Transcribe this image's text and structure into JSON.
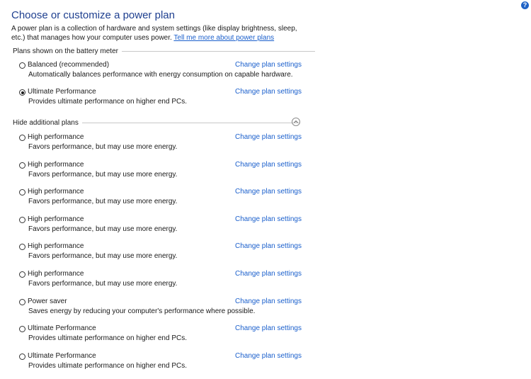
{
  "help_glyph": "?",
  "title": "Choose or customize a power plan",
  "intro": {
    "text": "A power plan is a collection of hardware and system settings (like display brightness, sleep, etc.) that manages how your computer uses power. ",
    "link": "Tell me more about power plans"
  },
  "sections": {
    "battery_meter": "Plans shown on the battery meter",
    "additional": "Hide additional plans"
  },
  "change_label": "Change plan settings",
  "plans_primary": [
    {
      "name": "Balanced (recommended)",
      "desc": "Automatically balances performance with energy consumption on capable hardware.",
      "checked": false
    },
    {
      "name": "Ultimate Performance",
      "desc": "Provides ultimate performance on higher end PCs.",
      "checked": true
    }
  ],
  "plans_additional": [
    {
      "name": "High performance",
      "desc": "Favors performance, but may use more energy.",
      "checked": false
    },
    {
      "name": "High performance",
      "desc": "Favors performance, but may use more energy.",
      "checked": false
    },
    {
      "name": "High performance",
      "desc": "Favors performance, but may use more energy.",
      "checked": false
    },
    {
      "name": "High performance",
      "desc": "Favors performance, but may use more energy.",
      "checked": false
    },
    {
      "name": "High performance",
      "desc": "Favors performance, but may use more energy.",
      "checked": false
    },
    {
      "name": "High performance",
      "desc": "Favors performance, but may use more energy.",
      "checked": false
    },
    {
      "name": "Power saver",
      "desc": "Saves energy by reducing your computer's performance where possible.",
      "checked": false
    },
    {
      "name": "Ultimate Performance",
      "desc": "Provides ultimate performance on higher end PCs.",
      "checked": false
    },
    {
      "name": "Ultimate Performance",
      "desc": "Provides ultimate performance on higher end PCs.",
      "checked": false
    }
  ],
  "colors": {
    "title": "#1e3f8f",
    "link": "#1a5fcc",
    "help_icon": "#1f63c6",
    "rule": "#c8c8c8"
  }
}
